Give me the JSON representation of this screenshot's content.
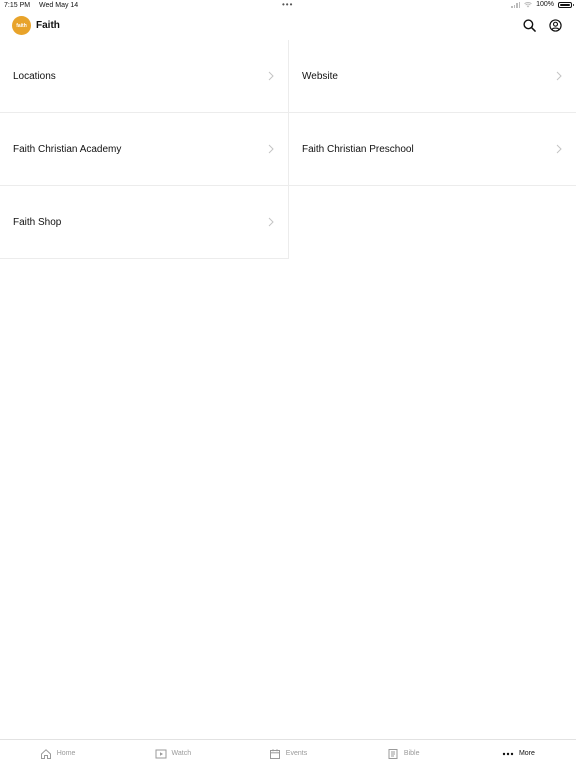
{
  "status_bar": {
    "time": "7:15 PM",
    "date": "Wed May 14",
    "battery": "100%"
  },
  "header": {
    "logo_text": "faith",
    "title": "Faith",
    "search_icon": "search-icon",
    "account_icon": "account-icon"
  },
  "menu": {
    "items": [
      {
        "label": "Locations"
      },
      {
        "label": "Website"
      },
      {
        "label": "Faith Christian Academy"
      },
      {
        "label": "Faith Christian Preschool"
      },
      {
        "label": "Faith Shop"
      }
    ]
  },
  "tab_bar": {
    "tabs": [
      {
        "label": "Home",
        "icon": "home-icon",
        "active": false
      },
      {
        "label": "Watch",
        "icon": "video-icon",
        "active": false
      },
      {
        "label": "Events",
        "icon": "calendar-icon",
        "active": false
      },
      {
        "label": "Bible",
        "icon": "book-icon",
        "active": false
      },
      {
        "label": "More",
        "icon": "more-icon",
        "active": true
      }
    ]
  },
  "colors": {
    "brand": "#e8a32a",
    "active_tab": "#111111",
    "inactive_tab": "#9a9a9a",
    "divider": "#ececec"
  }
}
